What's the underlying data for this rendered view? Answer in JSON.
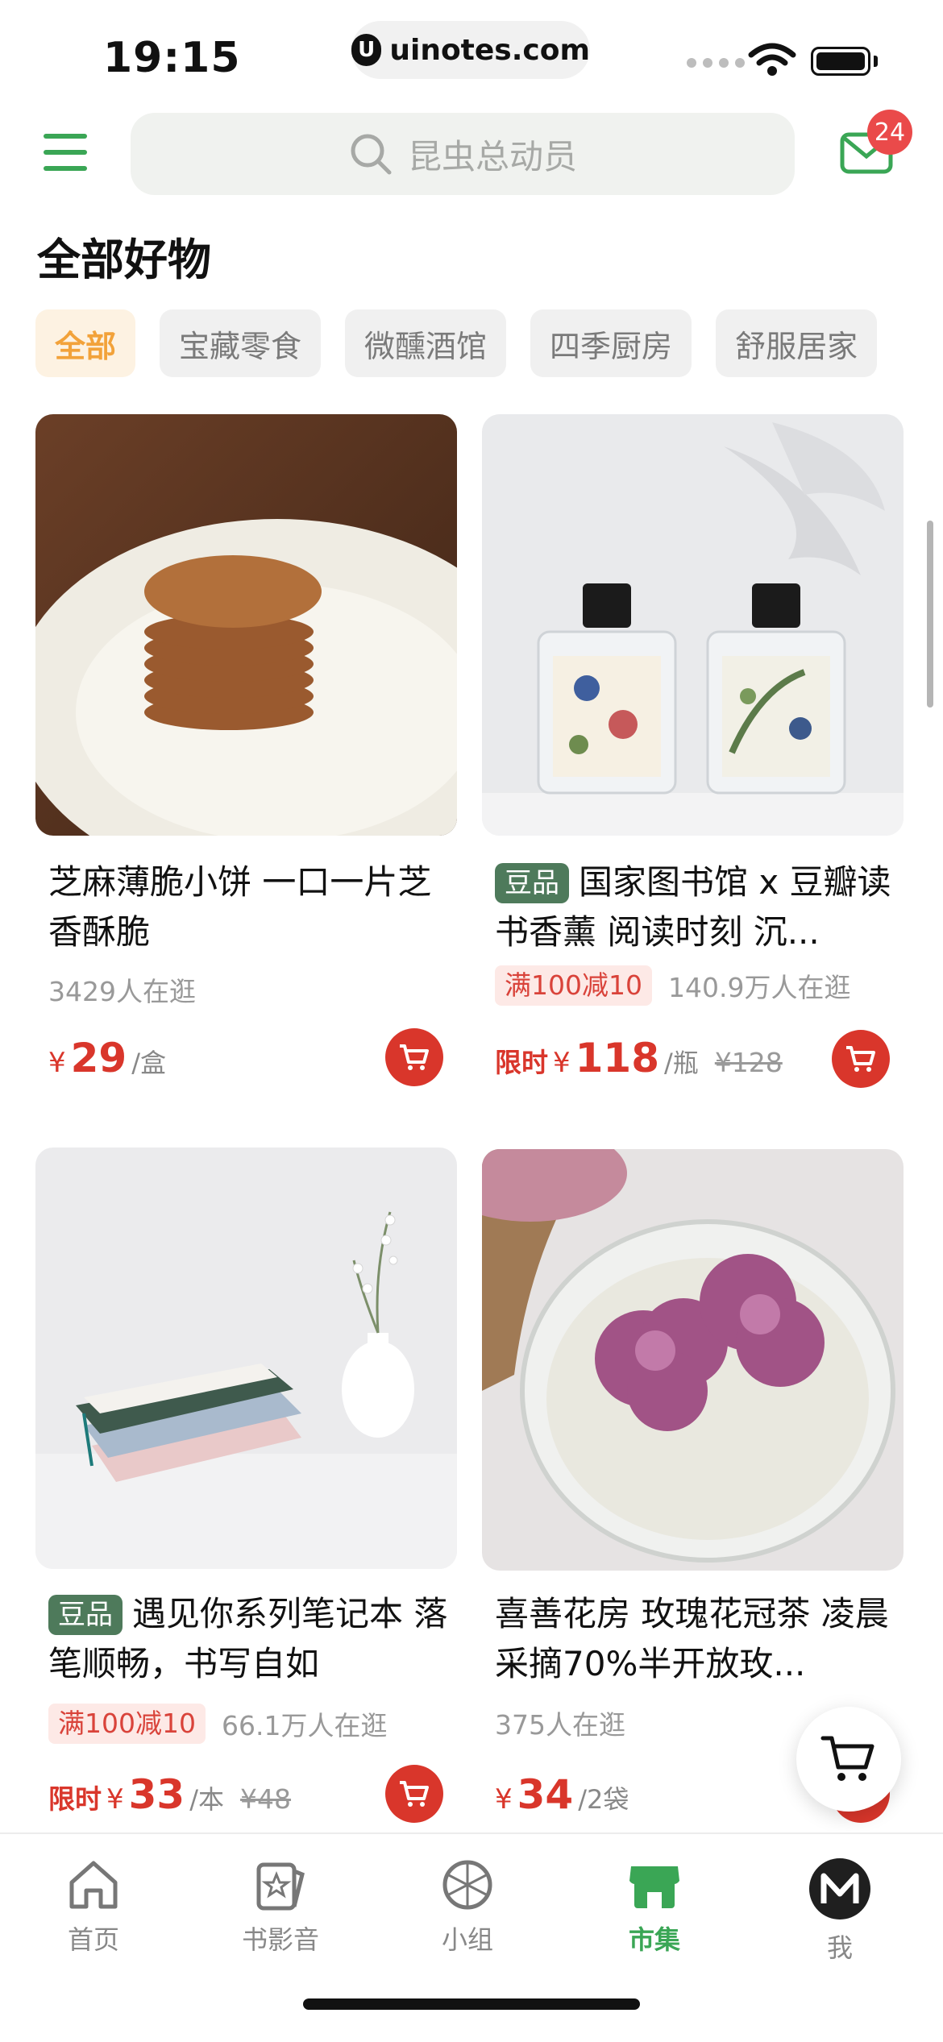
{
  "status_bar": {
    "time": "19:15",
    "url": "uinotes.com"
  },
  "header": {
    "search_placeholder": "昆虫总动员",
    "mail_badge": "24"
  },
  "section_title": "全部好物",
  "categories": [
    "全部",
    "宝藏零食",
    "微醺酒馆",
    "四季厨房",
    "舒服居家"
  ],
  "products": [
    {
      "title": "芝麻薄脆小饼 一口一片芝香酥脆",
      "tag": "",
      "promo": "",
      "visitors": "3429人在逛",
      "limited": "",
      "price": "29",
      "unit": "/盒",
      "original_price": ""
    },
    {
      "title": "国家图书馆 x 豆瓣读书香薰 阅读时刻 沉...",
      "tag": "豆品",
      "promo": "满100减10",
      "visitors": "140.9万人在逛",
      "limited": "限时",
      "price": "118",
      "unit": "/瓶",
      "original_price": "¥128"
    },
    {
      "title": "遇见你系列笔记本 落笔顺畅，书写自如",
      "tag": "豆品",
      "promo": "满100减10",
      "visitors": "66.1万人在逛",
      "limited": "限时",
      "price": "33",
      "unit": "/本",
      "original_price": "¥48"
    },
    {
      "title": "喜善花房 玫瑰花冠茶 凌晨采摘70%半开放玫...",
      "tag": "",
      "promo": "",
      "visitors": "375人在逛",
      "limited": "",
      "price": "34",
      "unit": "/2袋",
      "original_price": ""
    }
  ],
  "currency": "¥",
  "tabs": [
    "首页",
    "书影音",
    "小组",
    "市集",
    "我"
  ],
  "colors": {
    "brand_green": "#3aa655",
    "price_red": "#d9362b",
    "tag_green": "#4e7a5b"
  }
}
